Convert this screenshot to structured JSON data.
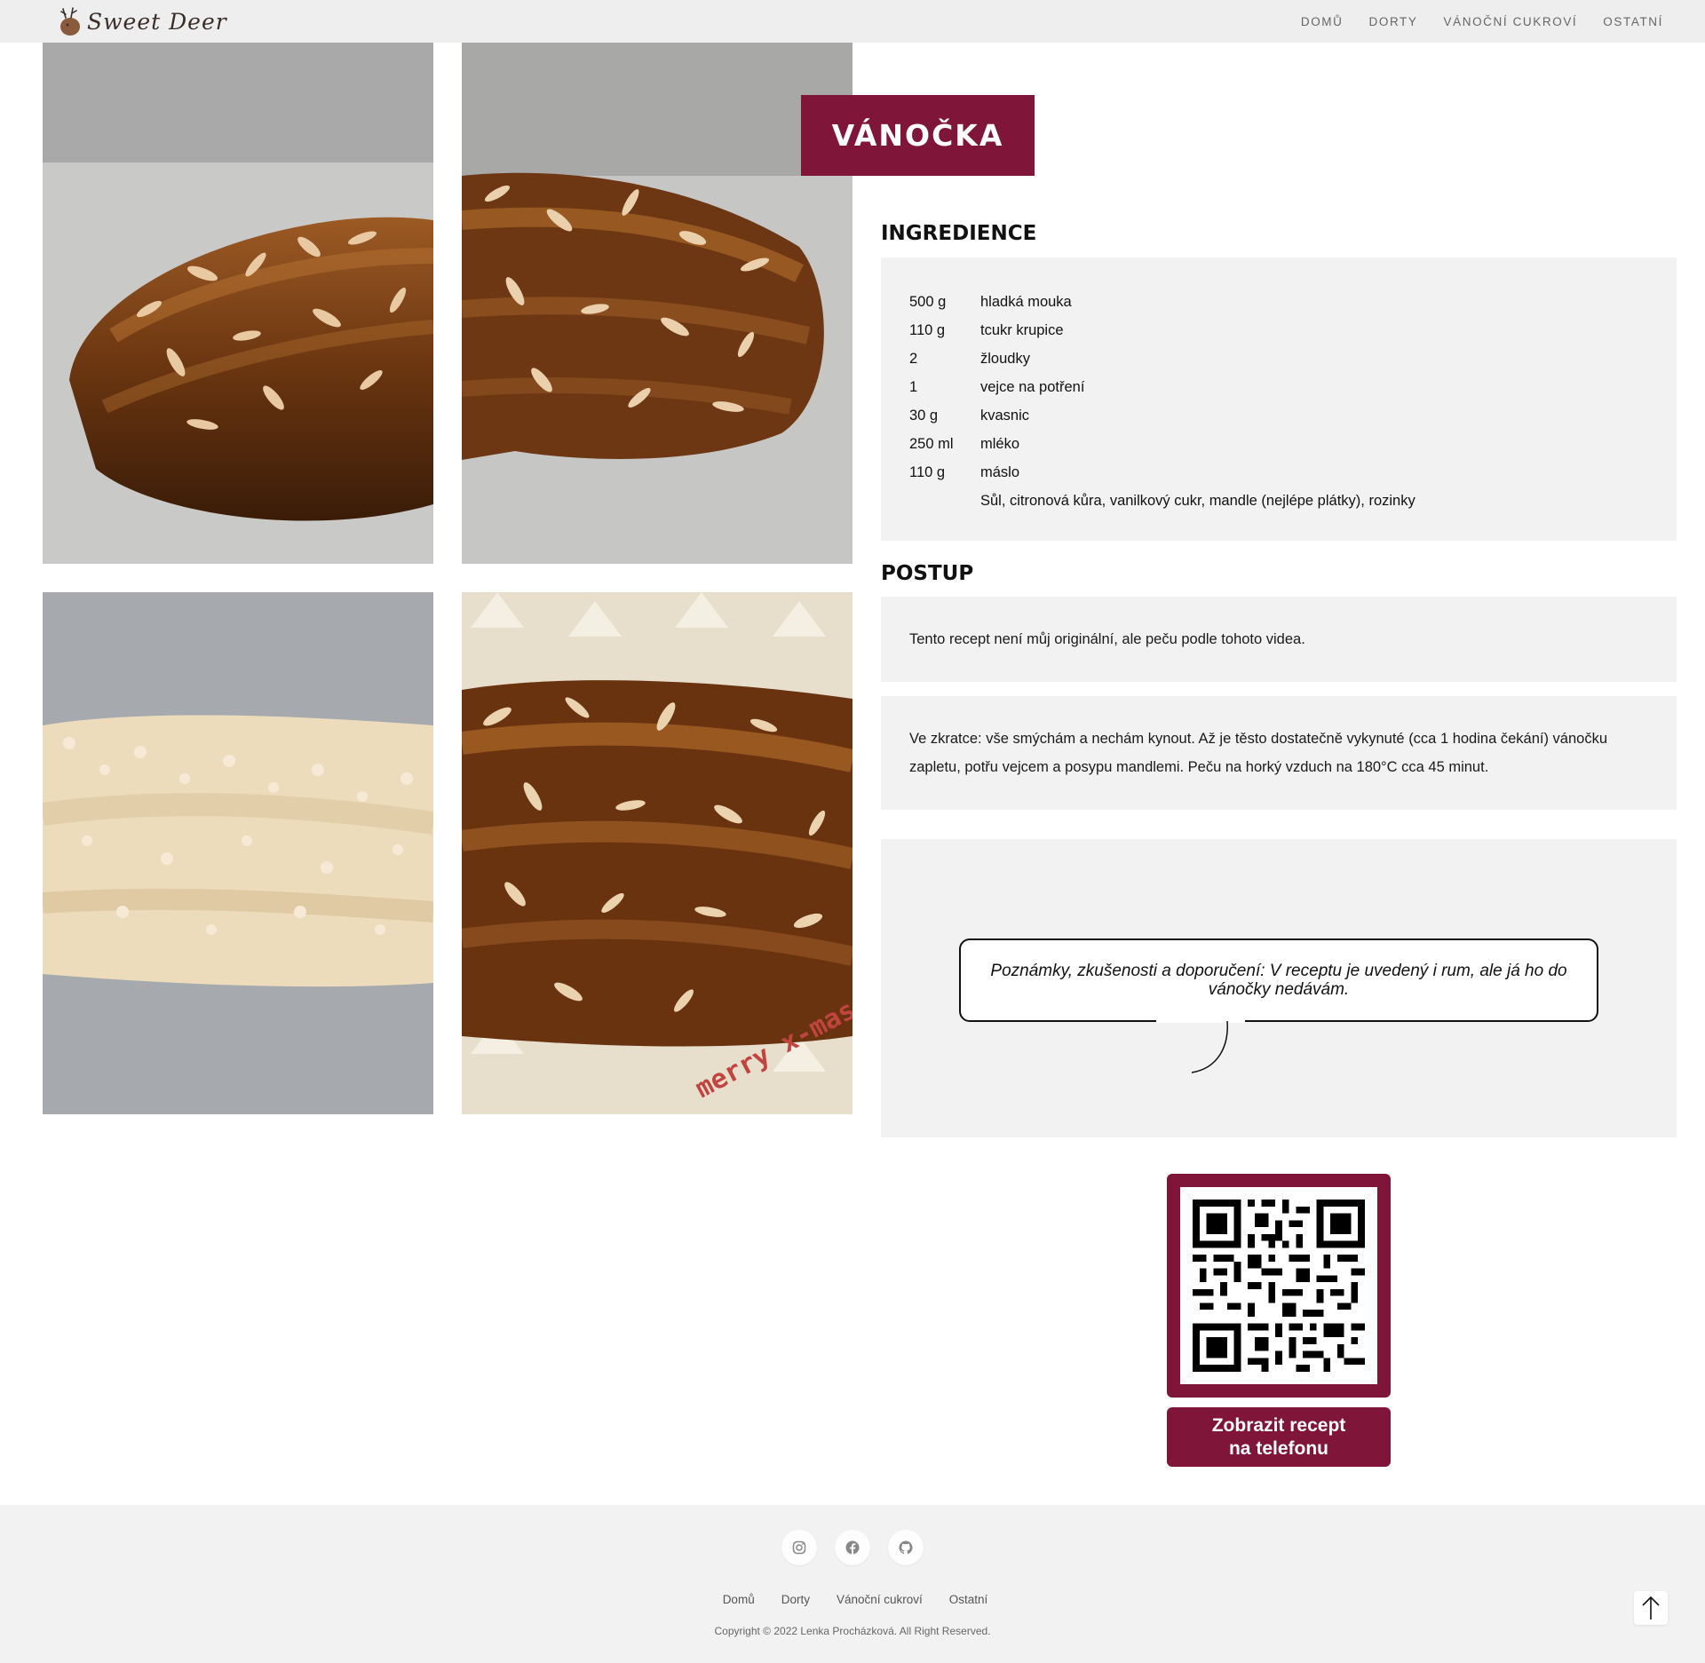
{
  "header": {
    "logo_text": "Sweet Deer",
    "nav": [
      {
        "label": "DOMŮ"
      },
      {
        "label": "DORTY"
      },
      {
        "label": "VÁNOČNÍ CUKROVÍ"
      },
      {
        "label": "OSTATNÍ"
      }
    ]
  },
  "recipe": {
    "title": "VÁNOČKA",
    "ingredients_heading": "INGREDIENCE",
    "ingredients": [
      {
        "qty": "500 g",
        "name": "hladká mouka"
      },
      {
        "qty": "110 g",
        "name": "tcukr krupice"
      },
      {
        "qty": "2",
        "name": "žloudky"
      },
      {
        "qty": "1",
        "name": "vejce na potření"
      },
      {
        "qty": "30 g",
        "name": "kvasnic"
      },
      {
        "qty": "250 ml",
        "name": "mléko"
      },
      {
        "qty": "110 g",
        "name": "máslo"
      },
      {
        "qty": "",
        "name": "Sůl, citronová kůra, vanilkový cukr, mandle (nejlépe plátky), rozinky"
      }
    ],
    "procedure_heading": "POSTUP",
    "procedure_intro": "Tento recept není můj originální, ale peču podle tohoto videa.",
    "procedure_text": "Ve zkratce: vše smýchám a nechám kynout. Až je těsto dostatečně vykynuté (cca 1 hodina čekání) vánočku zapletu, potřu vejcem a posypu mandlemi. Peču na horký vzduch na 180°C cca 45 minut.",
    "notes": "Poznámky, zkušenosti a doporučení: V receptu je uvedený i rum, ale já ho do vánočky nedávám.",
    "qr_button": "Zobrazit recept na telefonu"
  },
  "photo_text": "merry x-mas",
  "footer": {
    "social": [
      "instagram-icon",
      "facebook-icon",
      "github-icon"
    ],
    "links": [
      {
        "label": "Domů"
      },
      {
        "label": "Dorty"
      },
      {
        "label": "Vánoční cukroví"
      },
      {
        "label": "Ostatní"
      }
    ],
    "copyright": "Copyright © 2022 Lenka Procházková. All Right Reserved."
  },
  "colors": {
    "accent": "#7f1538",
    "panel_bg": "#f2f2f2",
    "header_bg": "#efeeef"
  }
}
